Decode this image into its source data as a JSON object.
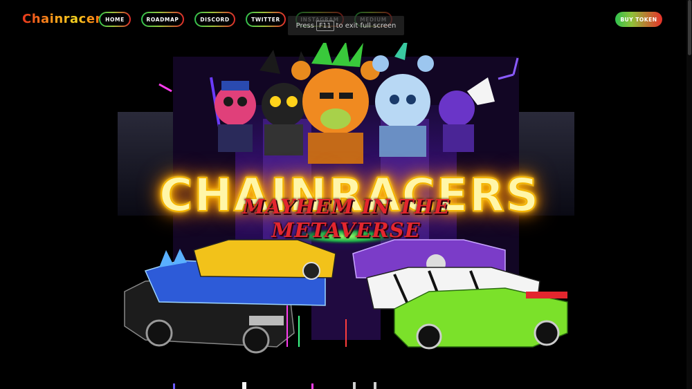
{
  "brand": {
    "logo_text": "ChainracerS"
  },
  "nav": {
    "items": [
      {
        "label": "HOME"
      },
      {
        "label": "ROADMAP"
      },
      {
        "label": "DISCORD"
      },
      {
        "label": "TWITTER"
      },
      {
        "label": "INSTAGRAM"
      },
      {
        "label": "MEDIUM"
      }
    ],
    "cta_label": "BUY TOKEN"
  },
  "toast": {
    "prefix": "Press",
    "key": "F11",
    "suffix": "to exit full screen"
  },
  "hero": {
    "title": "CHAINRACERS",
    "subtitle": "MAYHEM IN THE METAVERSE"
  },
  "colors": {
    "background": "#000000",
    "accent_green": "#2fc14e",
    "accent_red": "#e12a2a",
    "neon_yellow": "#ffd21a",
    "neon_purple": "#8a2be2"
  }
}
